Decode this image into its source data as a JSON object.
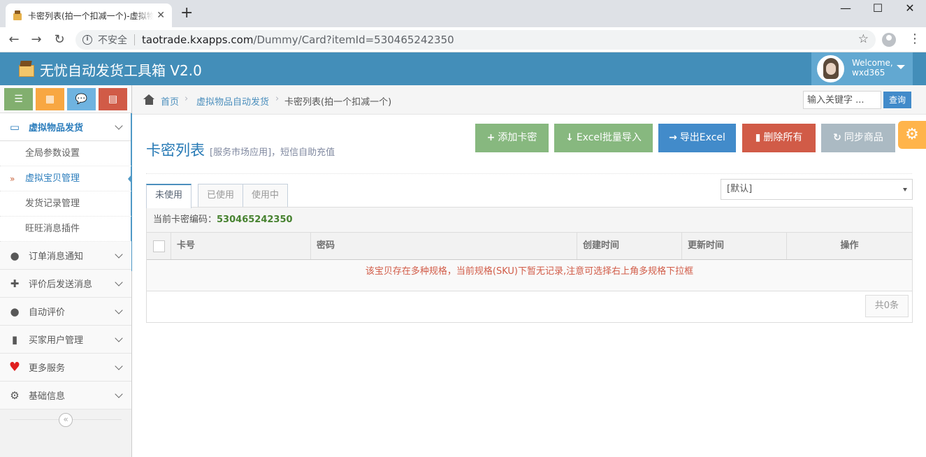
{
  "browser": {
    "tab_title": "卡密列表(拍一个扣减一个)-虚拟物品自动发货",
    "tab_close": "✕",
    "new_tab": "+",
    "security_label": "不安全",
    "url_host": "taotrade.kxapps.com",
    "url_path": "/Dummy/Card?itemId=530465242350",
    "window_controls": [
      "—",
      "☐",
      "✕"
    ]
  },
  "header": {
    "app_title": "无忧自动发货工具箱 V2.0",
    "welcome": "Welcome,",
    "username": "wxd365"
  },
  "shortcuts": [
    {
      "icon": "list-icon",
      "glyph": "☰",
      "color": "#82af6f"
    },
    {
      "icon": "calendar-icon",
      "glyph": "▦",
      "color": "#f8a742"
    },
    {
      "icon": "comment-icon",
      "glyph": "💬",
      "color": "#6fb3e0"
    },
    {
      "icon": "book-icon",
      "glyph": "▤",
      "color": "#d15b47"
    }
  ],
  "sidebar": {
    "open_group": "虚拟物品发货",
    "sub_items": [
      "全局参数设置",
      "虚拟宝贝管理",
      "发货记录管理",
      "旺旺消息插件"
    ],
    "active_sub": "虚拟宝贝管理",
    "groups": [
      {
        "label": "订单消息通知",
        "icon": "comment-icon",
        "glyph": "●",
        "color": "#555"
      },
      {
        "label": "评价后发送消息",
        "icon": "gift-icon",
        "glyph": "✚",
        "color": "#555"
      },
      {
        "label": "自动评价",
        "icon": "comment-icon",
        "glyph": "●",
        "color": "#555"
      },
      {
        "label": "买家用户管理",
        "icon": "book-icon",
        "glyph": "▮",
        "color": "#555"
      },
      {
        "label": "更多服务",
        "icon": "heart-icon",
        "glyph": "♥",
        "color": "#e02020"
      },
      {
        "label": "基础信息",
        "icon": "gear-icon",
        "glyph": "⚙",
        "color": "#555"
      }
    ],
    "collapse_glyph": "«"
  },
  "breadcrumb": {
    "home": "首页",
    "parent": "虚拟物品自动发货",
    "current": "卡密列表(拍一个扣减一个)",
    "sep": "›"
  },
  "search": {
    "placeholder": "输入关键字 ...",
    "button": "查询"
  },
  "page": {
    "title": "卡密列表",
    "subtitle": "[服务市场应用]，短信自助充值"
  },
  "actions": [
    {
      "label": "添加卡密",
      "glyph": "+",
      "color": "#87b87f"
    },
    {
      "label": "Excel批量导入",
      "glyph": "↓",
      "color": "#87b87f"
    },
    {
      "label": "导出Excel",
      "glyph": "→",
      "color": "#428bca"
    },
    {
      "label": "删除所有",
      "glyph": "▮",
      "color": "#d15b47"
    },
    {
      "label": "同步商品",
      "glyph": "↻",
      "color": "#abbac3"
    }
  ],
  "tabs": [
    "未使用",
    "已使用",
    "使用中"
  ],
  "active_tab": "未使用",
  "sku_select": {
    "value": "[默认]"
  },
  "panel": {
    "label": "当前卡密编码：",
    "code": "530465242350"
  },
  "table": {
    "columns": [
      "卡号",
      "密码",
      "创建时间",
      "更新时间",
      "操作"
    ],
    "empty_message": "该宝贝存在多种规格，当前规格(SKU)下暂无记录,注意可选择右上角多规格下拉框"
  },
  "pager": {
    "total": "共0条"
  }
}
